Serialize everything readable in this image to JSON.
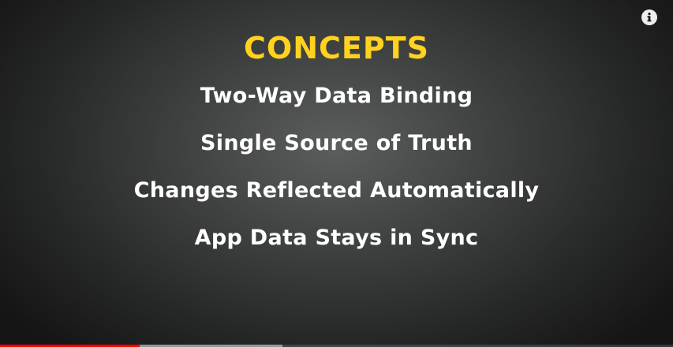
{
  "slide": {
    "title": "CONCEPTS",
    "bullets": [
      "Two-Way Data Binding",
      "Single Source of Truth",
      "Changes Reflected Automatically",
      "App Data Stays in Sync"
    ]
  },
  "player": {
    "info_icon": "info-icon",
    "played_fraction": 0.208,
    "buffered_fraction": 0.42
  },
  "colors": {
    "title": "#ffd21f",
    "bullet_text": "#ffffff",
    "progress_played": "#ff0000"
  }
}
